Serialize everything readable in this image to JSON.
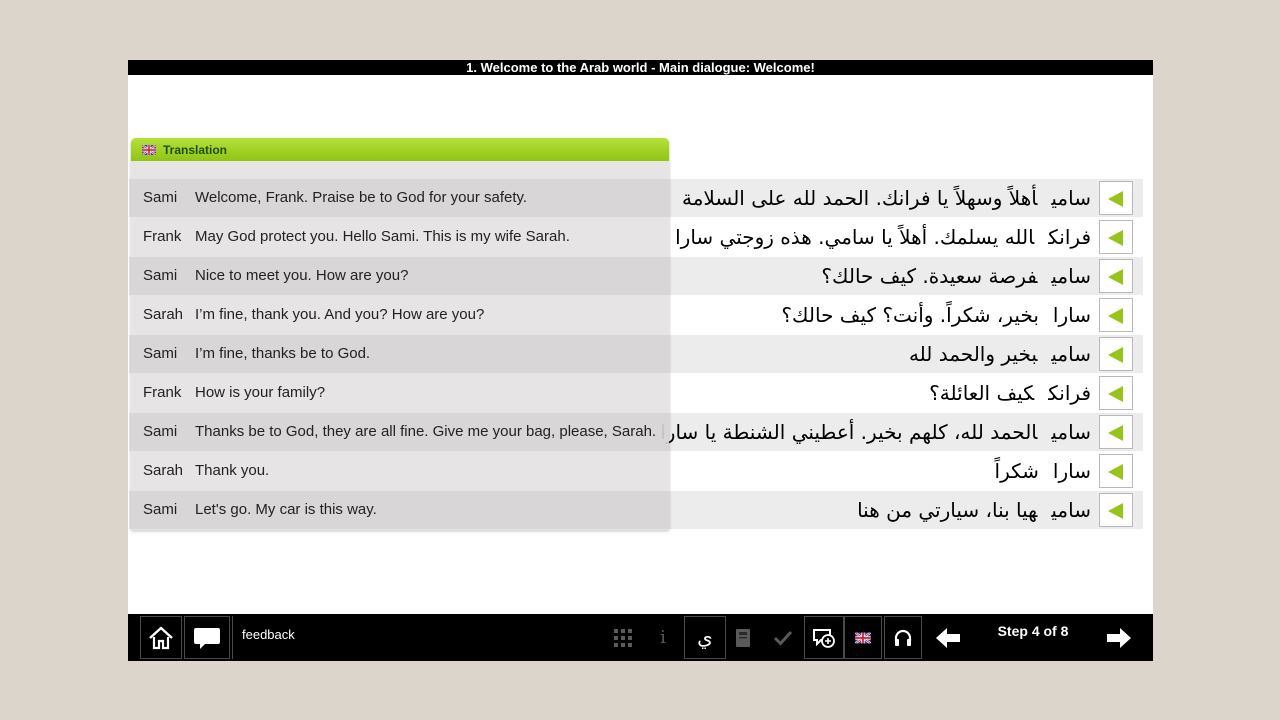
{
  "title": "1. Welcome to the Arab world - Main dialogue: Welcome!",
  "translation_panel": {
    "title": "Translation",
    "rows": [
      {
        "speaker": "Sami",
        "text": "Welcome, Frank. Praise be to God for your safety."
      },
      {
        "speaker": "Frank",
        "text": "May God protect you. Hello Sami. This is my wife Sarah."
      },
      {
        "speaker": "Sami",
        "text": "Nice to meet you. How are you?"
      },
      {
        "speaker": "Sarah",
        "text": "I’m fine, thank you. And you? How are you?"
      },
      {
        "speaker": "Sami",
        "text": "I’m fine, thanks be to God."
      },
      {
        "speaker": "Frank",
        "text": "How is your family?"
      },
      {
        "speaker": "Sami",
        "text": "Thanks be to God, they are all fine. Give me your bag, please, Sarah."
      },
      {
        "speaker": "Sarah",
        "text": "Thank you."
      },
      {
        "speaker": "Sami",
        "text": "Let's go. My car is this way."
      }
    ]
  },
  "dialogue": [
    {
      "speaker": "سامي",
      "text": "أهلاً وسهلاً يا فرانك. الحمد لله على السلامة"
    },
    {
      "speaker": "فرانك",
      "text": "الله يسلمك. أهلاً يا سامي. هذه زوجتي سارا"
    },
    {
      "speaker": "سامي",
      "text": "فرصة سعيدة. كيف حالك؟"
    },
    {
      "speaker": "سارا",
      "text": "بخير، شكراً. وأنت؟ كيف حالك؟"
    },
    {
      "speaker": "سامي",
      "text": "بخير والحمد لله"
    },
    {
      "speaker": "فرانك",
      "text": "كيف العائلة؟"
    },
    {
      "speaker": "سامي",
      "text": "الحمد لله، كلهم بخير. أعطيني الشنطة يا سارا"
    },
    {
      "speaker": "سارا",
      "text": "شكراً"
    },
    {
      "speaker": "سامي",
      "text": "هيا بنا، سيارتي من هنا"
    }
  ],
  "toolbar": {
    "feedback_label": "feedback",
    "arabic_keyboard_glyph": "ي",
    "info_glyph": "i",
    "step_label": "Step 4 of 8"
  },
  "colors": {
    "accent_green": "#97c41a",
    "header_green": "#8ec514",
    "toolbar_bg": "#000000",
    "disabled_icon": "#5a5a5a"
  },
  "icons": [
    "home-icon",
    "speech-bubble-icon",
    "grid-icon",
    "info-icon",
    "arabic-keyboard-icon",
    "notebook-icon",
    "checkmark-icon",
    "speech-translate-icon",
    "uk-flag-icon",
    "headphones-icon",
    "arrow-left-icon",
    "arrow-right-icon",
    "play-icon"
  ]
}
